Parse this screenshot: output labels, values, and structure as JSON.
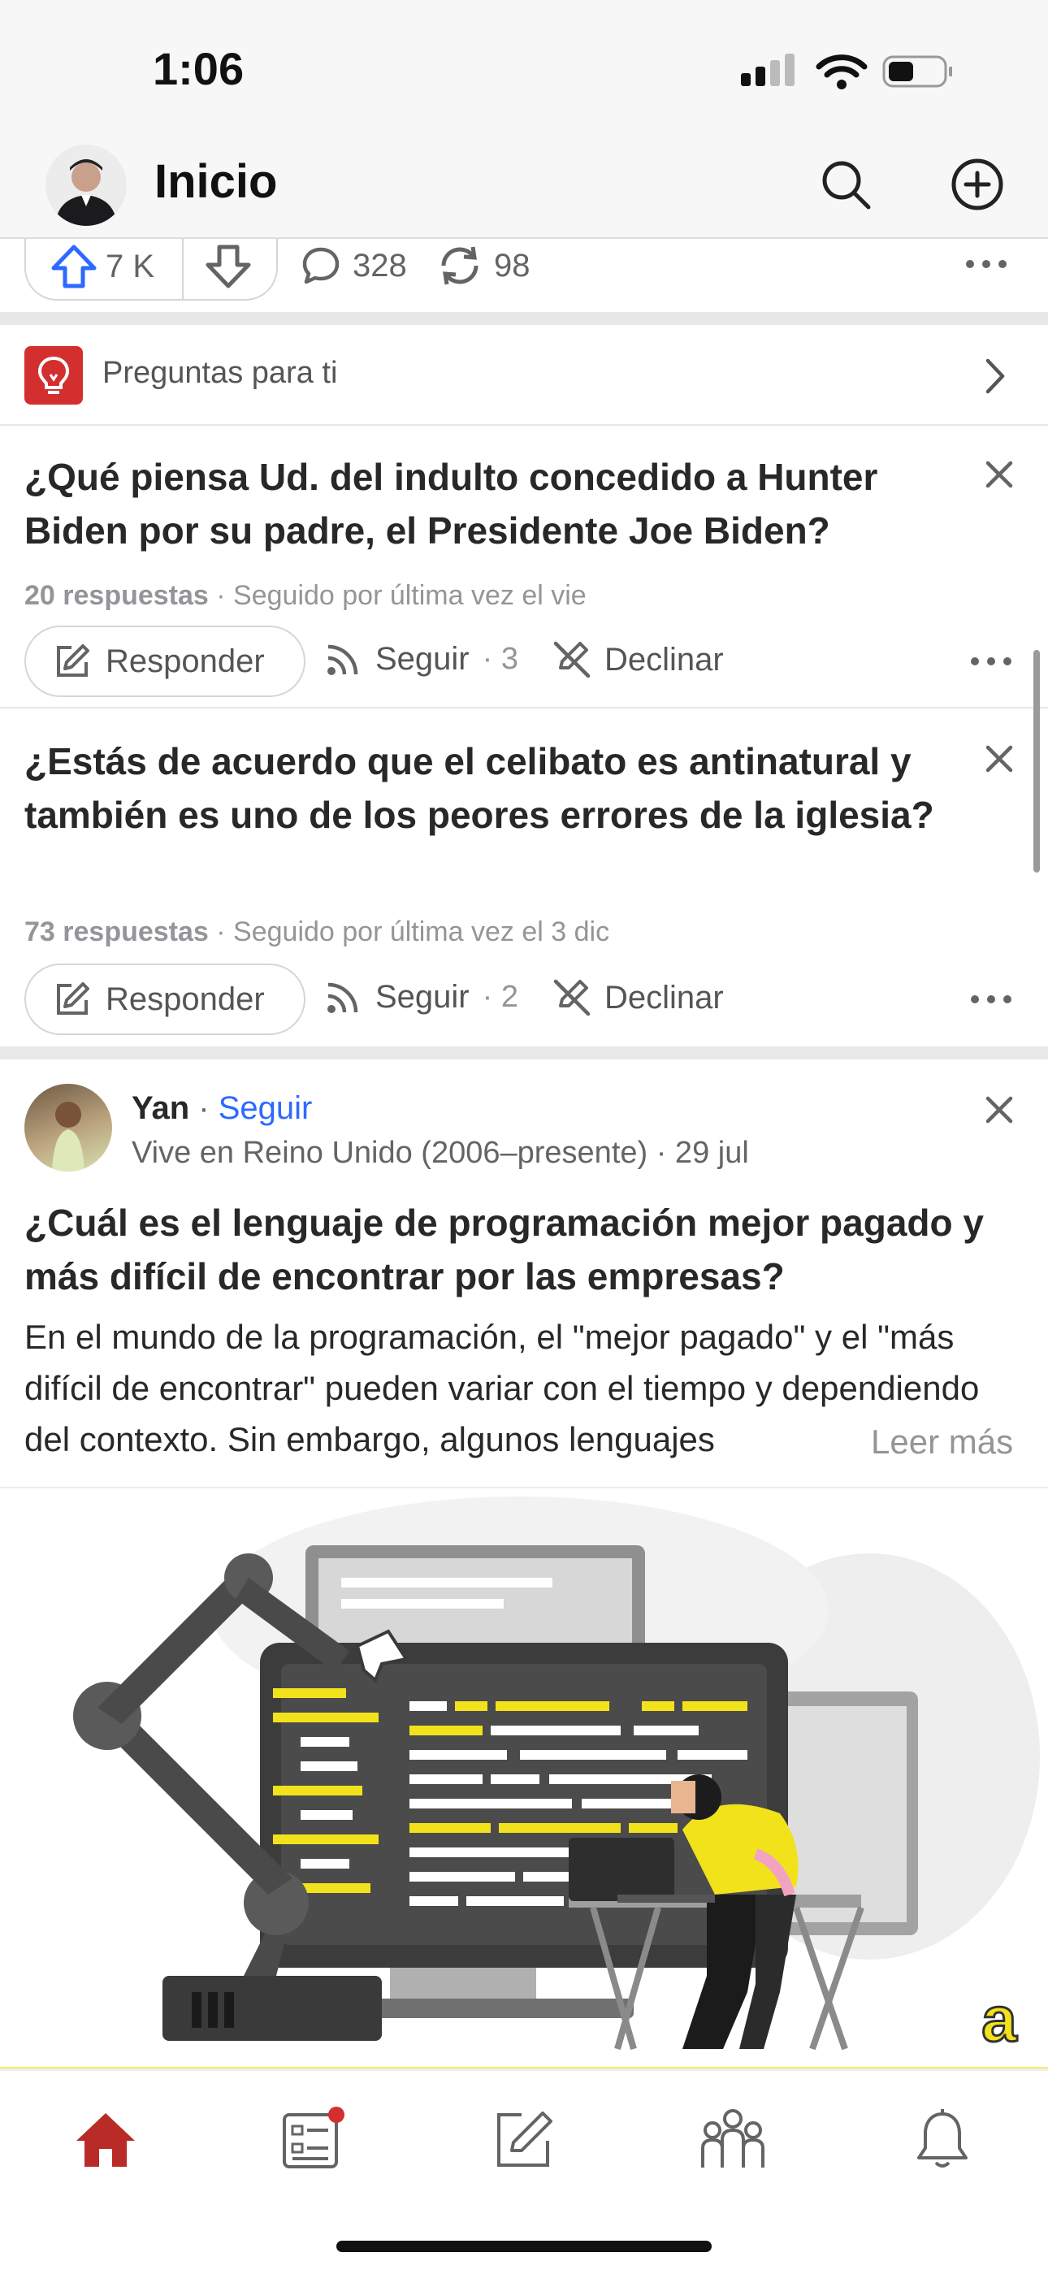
{
  "status": {
    "time": "1:06"
  },
  "header": {
    "title": "Inicio",
    "search_icon": "search-icon",
    "add_icon": "plus-circle-icon"
  },
  "prev_post_actions": {
    "upvotes": "7 K",
    "comments": "328",
    "shares": "98"
  },
  "questions": {
    "header": "Preguntas para ti",
    "items": [
      {
        "title": "¿Qué piensa Ud. del indulto concedido a Hunter Biden por su padre, el Presidente Joe Biden?",
        "answers": "20 respuestas",
        "followed": "· Seguido por última vez el vie",
        "answer_label": "Responder",
        "follow_label": "Seguir",
        "follow_count": "· 3",
        "decline_label": "Declinar"
      },
      {
        "title": "¿Estás de acuerdo que el celibato es antinatural y también es uno de los peores errores de la iglesia?",
        "answers": "73 respuestas",
        "followed": "· Seguido por última vez el 3 dic",
        "answer_label": "Responder",
        "follow_label": "Seguir",
        "follow_count": "· 2",
        "decline_label": "Declinar"
      }
    ]
  },
  "post": {
    "author": "Yan",
    "follow_label": "Seguir",
    "credential": "Vive en Reino Unido  (2006–presente) · 29 jul",
    "title": "¿Cuál es el lenguaje de programación mejor pagado y más difícil de encontrar por las empresas?",
    "body": "En el mundo de la programación, el \"mejor pagado\" y el \"más difícil de encontrar\" pueden variar con el tiempo y dependiendo del contexto. Sin embargo, algunos lenguajes",
    "read_more": "Leer más",
    "image_logo": "a"
  },
  "colors": {
    "accent": "#b92b27",
    "link": "#2e69ff",
    "code_yellow": "#f2e21c"
  },
  "tabbar": [
    "home-icon",
    "following-icon",
    "answer-icon",
    "spaces-icon",
    "notifications-icon"
  ]
}
